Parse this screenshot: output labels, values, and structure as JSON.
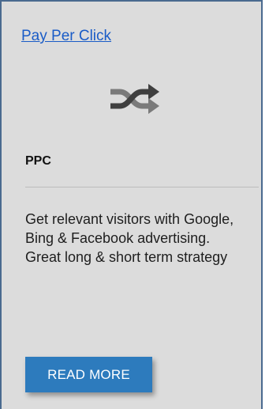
{
  "card": {
    "title_link": "Pay Per Click",
    "icon": "shuffle-icon",
    "heading": "PPC",
    "description": "Get relevant visitors with Google, Bing & Facebook advertising. Great long & short term strategy",
    "button_label": "READ MORE"
  },
  "colors": {
    "link": "#1a5cc7",
    "button": "#2d7bbd",
    "card_background": "#dcdcdc",
    "border": "#4a6a8f"
  }
}
